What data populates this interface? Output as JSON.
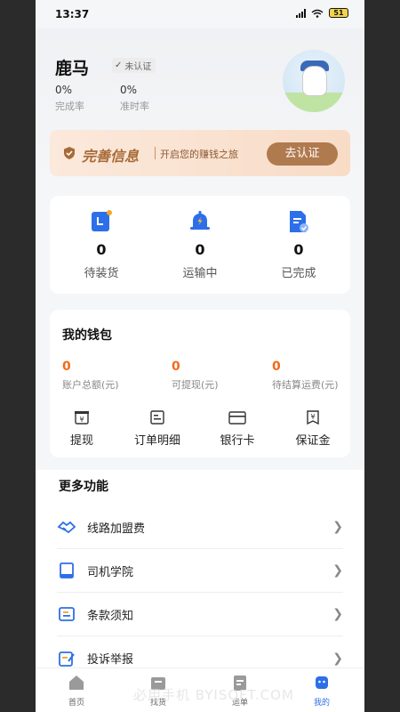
{
  "status_bar": {
    "time": "13:37",
    "battery": "51"
  },
  "profile": {
    "name": "鹿马",
    "verify_badge": "未认证",
    "stats": [
      {
        "value": "0%",
        "label": "完成率"
      },
      {
        "value": "0%",
        "label": "准时率"
      }
    ]
  },
  "banner": {
    "title": "完善信息",
    "subtitle": "开启您的赚钱之旅",
    "button": "去认证"
  },
  "orders": [
    {
      "count": "0",
      "label": "待装货",
      "icon": "pending-load-icon"
    },
    {
      "count": "0",
      "label": "运输中",
      "icon": "bell-icon"
    },
    {
      "count": "0",
      "label": "已完成",
      "icon": "document-check-icon"
    }
  ],
  "wallet": {
    "title": "我的钱包",
    "values": [
      {
        "amount": "0",
        "label": "账户总额(元)"
      },
      {
        "amount": "0",
        "label": "可提现(元)"
      },
      {
        "amount": "0",
        "label": "待结算运费(元)"
      }
    ],
    "actions": [
      {
        "label": "提现",
        "icon": "withdraw-icon"
      },
      {
        "label": "订单明细",
        "icon": "order-detail-icon"
      },
      {
        "label": "银行卡",
        "icon": "bank-card-icon"
      },
      {
        "label": "保证金",
        "icon": "deposit-icon"
      }
    ]
  },
  "more": {
    "title": "更多功能",
    "items": [
      {
        "label": "线路加盟费",
        "icon": "handshake-icon"
      },
      {
        "label": "司机学院",
        "icon": "book-icon"
      },
      {
        "label": "条款须知",
        "icon": "terms-icon"
      },
      {
        "label": "投诉举报",
        "icon": "complaint-icon"
      }
    ]
  },
  "nav": {
    "tabs": [
      {
        "label": "首页",
        "icon": "home-icon"
      },
      {
        "label": "找货",
        "icon": "cargo-icon"
      },
      {
        "label": "运单",
        "icon": "waybill-icon"
      },
      {
        "label": "我的",
        "icon": "profile-icon"
      }
    ],
    "active_index": 3
  },
  "watermark": "必用手机 BYISOFT.COM",
  "colors": {
    "accent_blue": "#2d6fe8",
    "amount_orange": "#f26a1b",
    "banner_brown": "#b07a4f"
  }
}
